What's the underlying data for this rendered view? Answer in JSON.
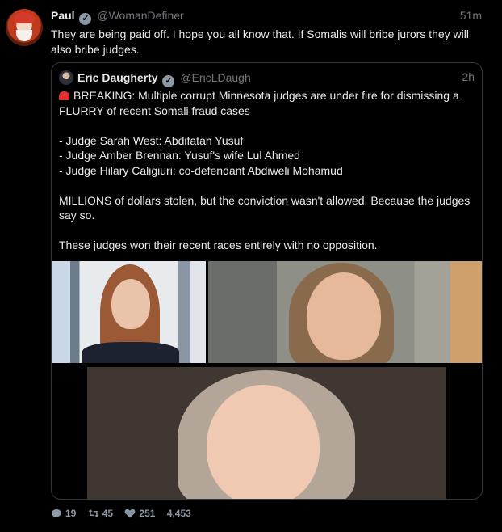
{
  "tweet": {
    "author_name": "Paul",
    "author_handle": "@WomanDefiner",
    "time": "51m",
    "text": "They are being paid off. I hope you all know that. If Somalis will bribe jurors they will also bribe judges."
  },
  "quote": {
    "author_name": "Eric Daugherty",
    "author_handle": "@EricLDaugh",
    "time": "2h",
    "paragraphs": [
      "BREAKING: Multiple corrupt Minnesota judges are under fire for dismissing a FLURRY of recent Somali fraud cases",
      "- Judge Sarah West: Abdifatah Yusuf",
      "- Judge Amber Brennan: Yusuf's wife Lul Ahmed",
      "- Judge Hilary Caligiuri: co-defendant Abdiweli Mohamud",
      "MILLIONS of dollars stolen, but the conviction wasn't allowed. Because the judges say so.",
      "These judges won their recent races entirely with no opposition."
    ]
  },
  "actions": {
    "replies": "19",
    "retweets": "45",
    "likes": "251",
    "views": "4,453"
  },
  "colors": {
    "background": "#000000",
    "text": "#e7e9ea",
    "muted": "#71767b",
    "border": "#333639",
    "siren": "#e0312e"
  },
  "icons": [
    "verified-badge-icon",
    "siren-icon",
    "reply-icon",
    "retweet-icon",
    "like-icon"
  ]
}
